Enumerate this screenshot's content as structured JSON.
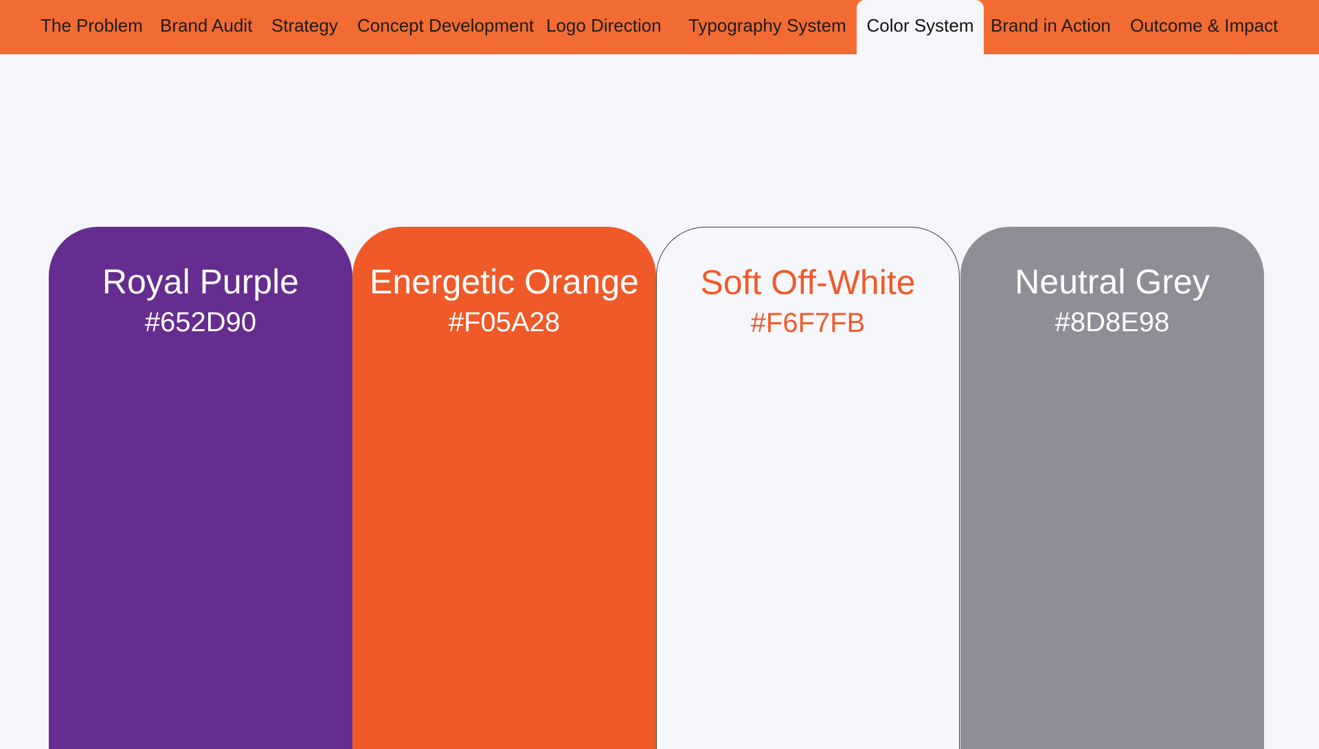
{
  "nav": {
    "items": [
      {
        "label": "The Problem"
      },
      {
        "label": "Brand Audit"
      },
      {
        "label": "Strategy"
      },
      {
        "label": "Concept Development"
      },
      {
        "label": "Logo Direction"
      },
      {
        "label": "Typography System"
      },
      {
        "label": "Color System",
        "active": true
      },
      {
        "label": "Brand in Action"
      },
      {
        "label": "Outcome & Impact"
      }
    ],
    "color": "#F26B33"
  },
  "palette": [
    {
      "name": "Royal Purple",
      "hex": "#652D90",
      "swatch": "#652D90",
      "text_color": "#FFFFFF"
    },
    {
      "name": "Energetic Orange",
      "hex": "#F05A28",
      "swatch": "#F05A28",
      "text_color": "#FFFFFF"
    },
    {
      "name": "Soft Off-White",
      "hex": "#F6F7FB",
      "swatch": "#F6F7FB",
      "text_color": "#F05A28"
    },
    {
      "name": "Neutral Grey",
      "hex": "#8D8E98",
      "swatch": "#8E8E97",
      "text_color": "#FFFFFF"
    }
  ]
}
